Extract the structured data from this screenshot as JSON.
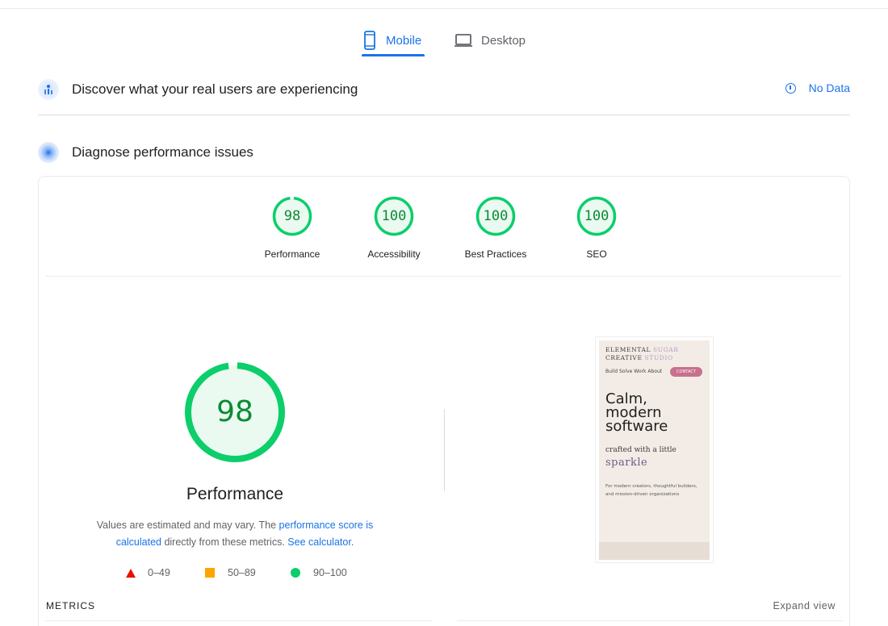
{
  "tabs": [
    {
      "label": "Mobile",
      "icon": "smartphone-icon",
      "active": true
    },
    {
      "label": "Desktop",
      "icon": "laptop-icon",
      "active": false
    }
  ],
  "field_data": {
    "title": "Discover what your real users are experiencing",
    "status": "No Data",
    "icon": "users-chart-icon"
  },
  "lab": {
    "title": "Diagnose performance issues",
    "icon": "diagnose-icon"
  },
  "gauges": [
    {
      "score": "98",
      "label": "Performance",
      "fraction": 0.98
    },
    {
      "score": "100",
      "label": "Accessibility",
      "fraction": 1.0
    },
    {
      "score": "100",
      "label": "Best Practices",
      "fraction": 1.0
    },
    {
      "score": "100",
      "label": "SEO",
      "fraction": 1.0
    }
  ],
  "main_score": {
    "score": "98",
    "fraction": 0.98,
    "label": "Performance",
    "desc_before": "Values are estimated and may vary. The ",
    "desc_link1": "performance score is calculated",
    "desc_middle": " directly from these metrics. ",
    "desc_link2": "See calculator",
    "desc_after": "."
  },
  "legend": [
    {
      "range": "0–49",
      "shape": "triangle",
      "color": "#eb0f00"
    },
    {
      "range": "50–89",
      "shape": "square",
      "color": "#ffa400"
    },
    {
      "range": "90–100",
      "shape": "circle",
      "color": "#0cce6b"
    }
  ],
  "screenshot": {
    "brand_line1_a": "ELEMENTAL ",
    "brand_line1_b": "SUGAR",
    "brand_line2_a": "CREATIVE ",
    "brand_line2_b": "STUDIO",
    "nav": "Build  Solve  Work  About",
    "contact": "CONTACT",
    "headline_1": "Calm,",
    "headline_2": "modern",
    "headline_3": "software",
    "sub": "crafted with a little",
    "sparkle": "sparkle",
    "small": "For modern creators, thoughtful builders, and mission-driven organizations"
  },
  "metrics": {
    "heading": "METRICS",
    "expand": "Expand view"
  },
  "colors": {
    "accent": "#1a73e8",
    "pass": "#0cce6b",
    "pass_text": "#0c8a33",
    "pass_bg": "#e6f8ee"
  }
}
